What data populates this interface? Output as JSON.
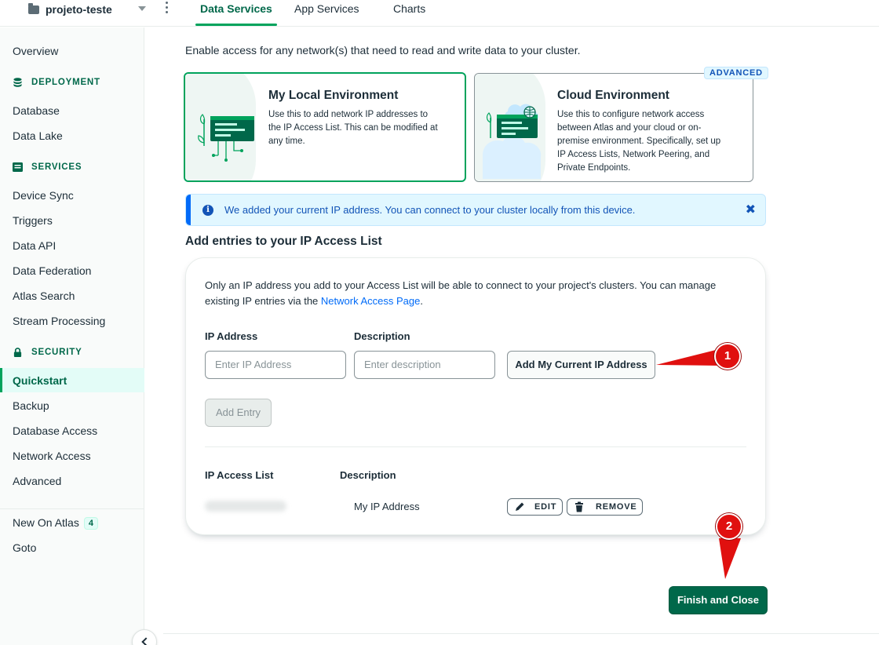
{
  "topbar": {
    "project_name": "projeto-teste",
    "tabs": [
      {
        "label": "Data Services"
      },
      {
        "label": "App Services"
      },
      {
        "label": "Charts"
      }
    ]
  },
  "sidebar": {
    "overview": "Overview",
    "deployment_heading": "DEPLOYMENT",
    "deployment_items": [
      "Database",
      "Data Lake"
    ],
    "services_heading": "SERVICES",
    "services_items": [
      "Device Sync",
      "Triggers",
      "Data API",
      "Data Federation",
      "Atlas Search",
      "Stream Processing"
    ],
    "security_heading": "SECURITY",
    "security_items": [
      "Quickstart",
      "Backup",
      "Database Access",
      "Network Access",
      "Advanced"
    ],
    "new_on_atlas": "New On Atlas",
    "new_on_atlas_count": "4",
    "goto": "Goto"
  },
  "main": {
    "intro": "Enable access for any network(s) that need to read and write data to your cluster.",
    "local_card": {
      "title": "My Local Environment",
      "desc_lines": [
        "Use this to add network IP addresses to",
        "the IP Access List. This can be modified at",
        "any time."
      ]
    },
    "cloud_card": {
      "badge": "ADVANCED",
      "title": "Cloud Environment",
      "desc_lines": [
        "Use this to configure network access",
        "between Atlas and your cloud or on-",
        "premise environment. Specifically, set up",
        "IP Access Lists, Network Peering, and",
        "Private Endpoints."
      ]
    },
    "banner": {
      "message": "We added your current IP address. You can connect to your cluster locally from this device.",
      "close": "✖"
    },
    "section_title": "Add entries to your IP Access List",
    "panel": {
      "desc_line1": "Only an IP address you add to your Access List will be able to connect to your project's clusters. You can manage",
      "desc_line2_prefix": "existing IP entries via the ",
      "desc_link": "Network Access Page",
      "desc_line2_suffix": ".",
      "ip_label": "IP Address",
      "ip_placeholder": "Enter IP Address",
      "desc_label": "Description",
      "desc_placeholder": "Enter description",
      "add_current_ip": "Add My Current IP Address",
      "add_entry": "Add Entry",
      "list_header_ip": "IP Access List",
      "list_header_desc": "Description",
      "rows": [
        {
          "description": "My IP Address",
          "edit": "EDIT",
          "remove": "REMOVE"
        }
      ]
    },
    "finish_button": "Finish and Close"
  },
  "annotations": {
    "marker1": "1",
    "marker2": "2",
    "color": "#e0100f"
  }
}
